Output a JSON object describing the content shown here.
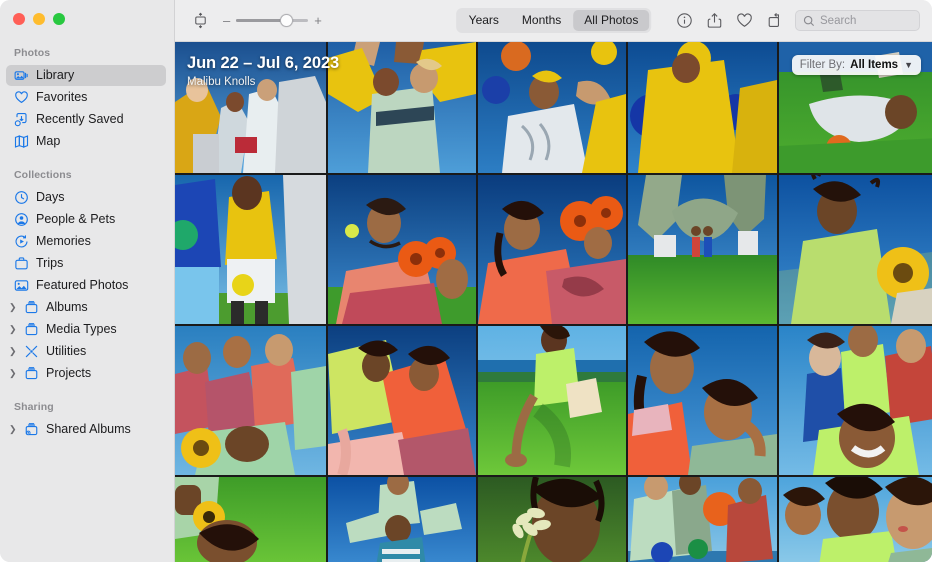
{
  "window": {
    "traffic_lights": [
      "close",
      "minimize",
      "zoom"
    ],
    "colors": {
      "close": "#ff5f57",
      "minimize": "#febc2e",
      "zoom": "#28c840",
      "accent": "#1b78e8"
    }
  },
  "sidebar": {
    "groups": [
      {
        "title": "Photos",
        "items": [
          {
            "label": "Library",
            "icon": "library-icon",
            "selected": true,
            "disclosure": false
          },
          {
            "label": "Favorites",
            "icon": "heart-icon",
            "selected": false,
            "disclosure": false
          },
          {
            "label": "Recently Saved",
            "icon": "recently-saved-icon",
            "selected": false,
            "disclosure": false
          },
          {
            "label": "Map",
            "icon": "map-icon",
            "selected": false,
            "disclosure": false
          }
        ]
      },
      {
        "title": "Collections",
        "items": [
          {
            "label": "Days",
            "icon": "clock-icon",
            "selected": false,
            "disclosure": false
          },
          {
            "label": "People & Pets",
            "icon": "person-circle-icon",
            "selected": false,
            "disclosure": false
          },
          {
            "label": "Memories",
            "icon": "memories-icon",
            "selected": false,
            "disclosure": false
          },
          {
            "label": "Trips",
            "icon": "suitcase-icon",
            "selected": false,
            "disclosure": false
          },
          {
            "label": "Featured Photos",
            "icon": "featured-photo-icon",
            "selected": false,
            "disclosure": false
          },
          {
            "label": "Albums",
            "icon": "album-icon",
            "selected": false,
            "disclosure": true
          },
          {
            "label": "Media Types",
            "icon": "album-icon",
            "selected": false,
            "disclosure": true
          },
          {
            "label": "Utilities",
            "icon": "utilities-icon",
            "selected": false,
            "disclosure": true
          },
          {
            "label": "Projects",
            "icon": "album-icon",
            "selected": false,
            "disclosure": true
          }
        ]
      },
      {
        "title": "Sharing",
        "items": [
          {
            "label": "Shared Albums",
            "icon": "shared-album-icon",
            "selected": false,
            "disclosure": true
          }
        ]
      }
    ]
  },
  "toolbar": {
    "aspect_icon": "aspect-ratio-icon",
    "zoom_out_label": "–",
    "zoom_in_label": "+",
    "zoom_value": 62,
    "segments": [
      {
        "label": "Years",
        "active": false
      },
      {
        "label": "Months",
        "active": false
      },
      {
        "label": "All Photos",
        "active": true
      }
    ],
    "right_icons": [
      {
        "name": "info-icon"
      },
      {
        "name": "share-icon"
      },
      {
        "name": "favorite-heart-icon"
      },
      {
        "name": "rotate-icon"
      }
    ],
    "search": {
      "placeholder": "Search",
      "value": "",
      "icon": "search-icon"
    }
  },
  "content": {
    "date_header": {
      "date_range": "Jun 22 – Jul 6, 2023",
      "location": "Malibu Knolls"
    },
    "filter": {
      "label": "Filter By:",
      "value": "All Items",
      "chevron": "chevron-down-icon"
    },
    "grid": {
      "columns": 5,
      "rows": 4,
      "photos": [
        {
          "id": "p1",
          "alt": "Group of friends in yellow and white huddling under blue sky"
        },
        {
          "id": "p2",
          "alt": "Friends circle viewed from below, yellow sweaters, blue sky"
        },
        {
          "id": "p3",
          "alt": "Person tossing colorful balls against deep blue sky"
        },
        {
          "id": "p4",
          "alt": "Person in yellow shirt holding blue and yellow balls"
        },
        {
          "id": "p5",
          "alt": "Person lying on green grass beside orange ball"
        },
        {
          "id": "p6",
          "alt": "Two people standing, blue and yellow shirts, holding balls"
        },
        {
          "id": "p7",
          "alt": "Person with braids looking up, orange gerbera flowers in hand"
        },
        {
          "id": "p8",
          "alt": "Person in coral sweater holding orange flowers to camera"
        },
        {
          "id": "p9",
          "alt": "Person arching backward on grass, two figures in background"
        },
        {
          "id": "p10",
          "alt": "Person in green shirt sitting on grass holding sunflower"
        },
        {
          "id": "p11",
          "alt": "Friends laughing together on grass with sunflower"
        },
        {
          "id": "p12",
          "alt": "Two friends dancing, lime green and orange sweaters"
        },
        {
          "id": "p13",
          "alt": "Person in green sitting on grass hill with ocean behind"
        },
        {
          "id": "p14",
          "alt": "Two people leaning together, orange and sage clothing"
        },
        {
          "id": "p15",
          "alt": "Group of smiling friends piled together under blue sky"
        },
        {
          "id": "p16",
          "alt": "Person with sunflower lying on bright green grass"
        },
        {
          "id": "p17",
          "alt": "Person sitting on another's shoulders against blue sky"
        },
        {
          "id": "p18",
          "alt": "Person behind white agapanthus flower close-up"
        },
        {
          "id": "p19",
          "alt": "Friends playing with orange and blue balls on hilltop"
        },
        {
          "id": "p20",
          "alt": "Close portrait of three friends smiling outdoors"
        }
      ]
    }
  }
}
